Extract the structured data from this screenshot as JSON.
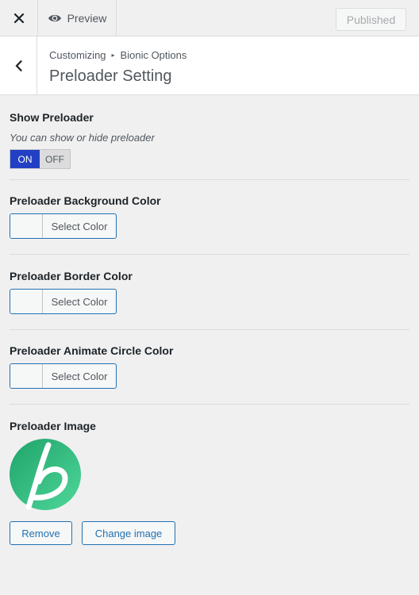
{
  "topbar": {
    "close_icon": "close-icon",
    "preview_label": "Preview",
    "preview_icon": "eye-icon",
    "published_label": "Published"
  },
  "section": {
    "back_icon": "chevron-left-icon",
    "breadcrumb_root": "Customizing",
    "breadcrumb_sep": "▸",
    "breadcrumb_parent": "Bionic Options",
    "title": "Preloader Setting"
  },
  "controls": {
    "show_preloader": {
      "title": "Show Preloader",
      "description": "You can show or hide preloader",
      "on_label": "ON",
      "off_label": "OFF",
      "value": "ON"
    },
    "background_color": {
      "title": "Preloader Background Color",
      "button_label": "Select Color"
    },
    "border_color": {
      "title": "Preloader Border Color",
      "button_label": "Select Color"
    },
    "circle_color": {
      "title": "Preloader Animate Circle Color",
      "button_label": "Select Color"
    },
    "image": {
      "title": "Preloader Image",
      "remove_label": "Remove",
      "change_label": "Change image"
    }
  },
  "colors": {
    "accent": "#2271b1",
    "toggle_on": "#2340c4",
    "logo_green": "#2fb57a"
  }
}
